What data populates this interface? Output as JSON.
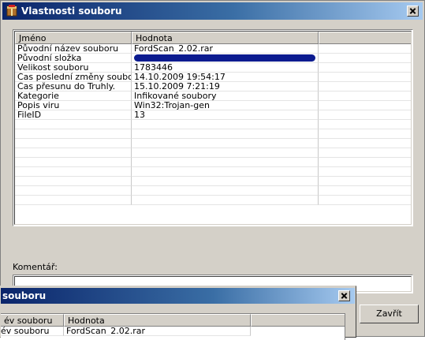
{
  "window": {
    "title": "Vlastnosti souboru",
    "icon": "archive-icon"
  },
  "table": {
    "columns": [
      "Jméno",
      "Hodnota"
    ],
    "rows": [
      {
        "name": "Původní název souboru",
        "value": "FordScan_2.02.rar"
      },
      {
        "name": "Původní složka",
        "value": "",
        "redacted": true
      },
      {
        "name": "Velikost souboru",
        "value": "1783446"
      },
      {
        "name": "Čas poslední změny souboru",
        "value": "14.10.2009 19:54:17"
      },
      {
        "name": "Čas přesunu do Truhly.",
        "value": "15.10.2009 7:21:19"
      },
      {
        "name": "Kategorie",
        "value": "Infikované soubory"
      },
      {
        "name": "Popis viru",
        "value": "Win32:Trojan-gen"
      },
      {
        "name": "FileID",
        "value": "13"
      }
    ]
  },
  "comment": {
    "label": "Komentář:",
    "value": ""
  },
  "buttons": {
    "close_label": "Zavřít"
  },
  "second_window": {
    "title": "souboru",
    "columns": [
      "év souboru",
      "Hodnota"
    ],
    "rows": [
      {
        "name": "év souboru",
        "value": "FordScan_2.02.rar"
      }
    ]
  },
  "colors": {
    "title_bar_start": "#0a246a",
    "title_bar_end": "#a6caf0",
    "dialog_face": "#d4d0c8",
    "redaction": "#0b1b8f"
  }
}
